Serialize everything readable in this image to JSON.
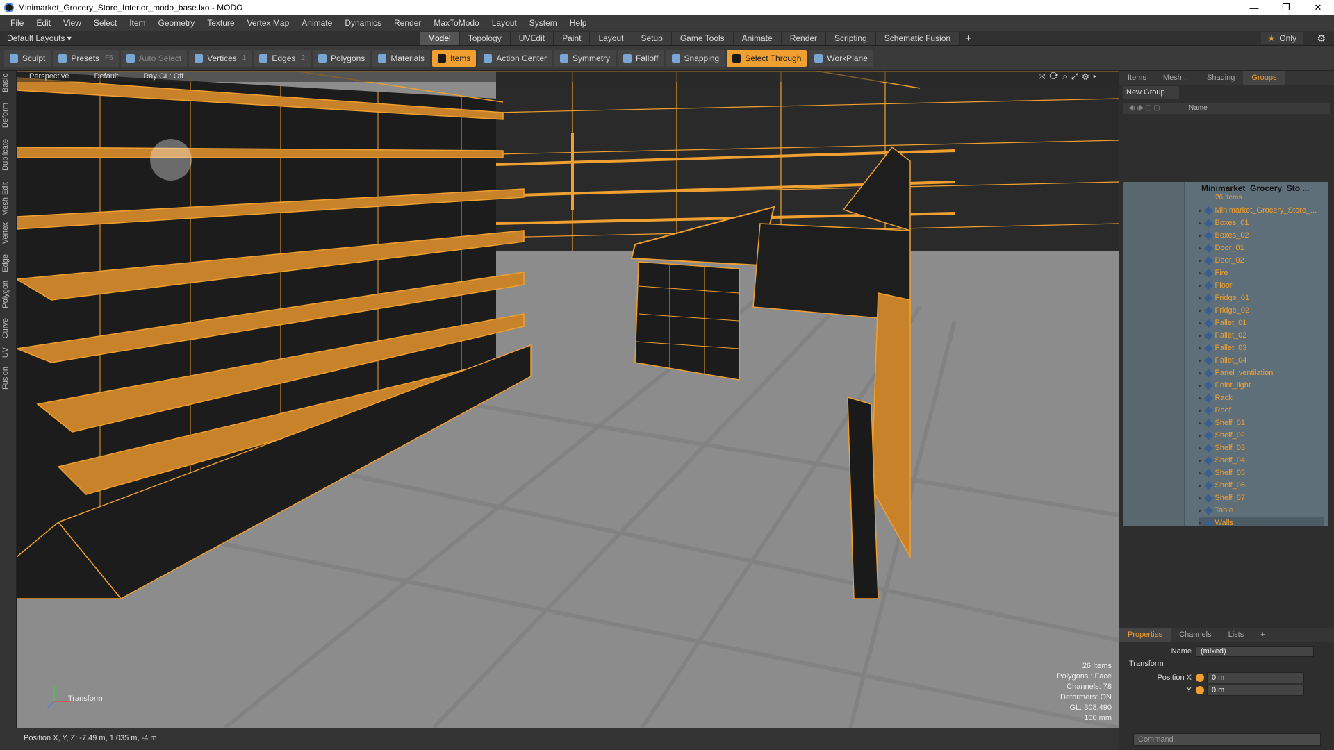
{
  "window": {
    "title": "Minimarket_Grocery_Store_Interior_modo_base.lxo - MODO",
    "min": "—",
    "max": "❐",
    "close": "✕"
  },
  "menu": [
    "File",
    "Edit",
    "View",
    "Select",
    "Item",
    "Geometry",
    "Texture",
    "Vertex Map",
    "Animate",
    "Dynamics",
    "Render",
    "MaxToModo",
    "Layout",
    "System",
    "Help"
  ],
  "layoutbar": {
    "default_layouts": "Default Layouts ▾",
    "tabs": [
      "Model",
      "Topology",
      "UVEdit",
      "Paint",
      "Layout",
      "Setup",
      "Game Tools",
      "Animate",
      "Render",
      "Scripting",
      "Schematic Fusion"
    ],
    "active_tab": "Model",
    "plus": "+",
    "only": "Only",
    "star": "★",
    "gear": "⚙"
  },
  "toolbar": {
    "sculpt": "Sculpt",
    "presets": "Presets",
    "presets_key": "F6",
    "auto_select": "Auto Select",
    "vertices": "Vertices",
    "vertices_count": "1",
    "edges": "Edges",
    "edges_count": "2",
    "polygons": "Polygons",
    "materials": "Materials",
    "items": "Items",
    "action_center": "Action Center",
    "symmetry": "Symmetry",
    "falloff": "Falloff",
    "snapping": "Snapping",
    "select_through": "Select Through",
    "workplane": "WorkPlane"
  },
  "left_tabs": [
    "Basic",
    "Deform",
    "Duplicate",
    "Mesh Edit",
    "Vertex",
    "Edge",
    "Polygon",
    "Curve",
    "UV",
    "Fusion"
  ],
  "viewport": {
    "header": [
      "Perspective",
      "Default",
      "Ray GL: Off"
    ],
    "stats": [
      "26 Items",
      "Polygons : Face",
      "Channels: 78",
      "Deformers: ON",
      "GL: 308,490",
      "100 mm"
    ],
    "gizmo_label": "Transform"
  },
  "status": "Position X, Y, Z:  -7.49 m, 1.035 m, -4 m",
  "panel": {
    "tabs": [
      "Items",
      "Mesh ...",
      "Shading",
      "Groups"
    ],
    "active_tab": "Groups",
    "new_group": "New Group",
    "name_header": "Name",
    "root": "Minimarket_Grocery_Sto ...",
    "root_count": "26 Items",
    "items": [
      "Minimarket_Grocery_Store_...",
      "Boxes_01",
      "Boxes_02",
      "Door_01",
      "Door_02",
      "Fire",
      "Floor",
      "Fridge_01",
      "Fridge_02",
      "Pallet_01",
      "Pallet_02",
      "Pallet_03",
      "Pallet_04",
      "Panel_ventilation",
      "Point_light",
      "Rack",
      "Roof",
      "Shelf_01",
      "Shelf_02",
      "Shelf_03",
      "Shelf_04",
      "Shelf_05",
      "Shelf_06",
      "Shelf_07",
      "Table",
      "Walls"
    ]
  },
  "properties": {
    "tabs": [
      "Properties",
      "Channels",
      "Lists",
      "+"
    ],
    "name_label": "Name",
    "name_value": "(mixed)",
    "transform": "Transform",
    "pos_x_label": "Position X",
    "pos_x": "0 m",
    "pos_y_label": "Y",
    "pos_y": "0 m",
    "command_placeholder": "Command"
  },
  "colors": {
    "accent": "#f0a030",
    "viewport_bg": "#8c8c8c",
    "panel_bg": "#2e2e2e"
  }
}
